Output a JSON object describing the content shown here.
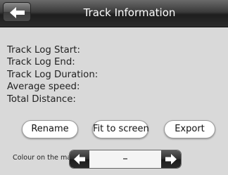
{
  "header": {
    "title": "Track Information",
    "back_icon": "arrow-left-icon"
  },
  "info_fields": [
    {
      "label": "Track Log Start:"
    },
    {
      "label": "Track Log End:"
    },
    {
      "label": "Track Log Duration:"
    },
    {
      "label": "Average speed:"
    },
    {
      "label": "Total Distance:"
    }
  ],
  "actions": {
    "rename_label": "Rename",
    "fit_label": "Fit to screen",
    "export_label": "Export"
  },
  "colour": {
    "label": "Colour on the map:",
    "value": "–",
    "prev_icon": "arrow-left-icon",
    "next_icon": "arrow-right-icon"
  }
}
